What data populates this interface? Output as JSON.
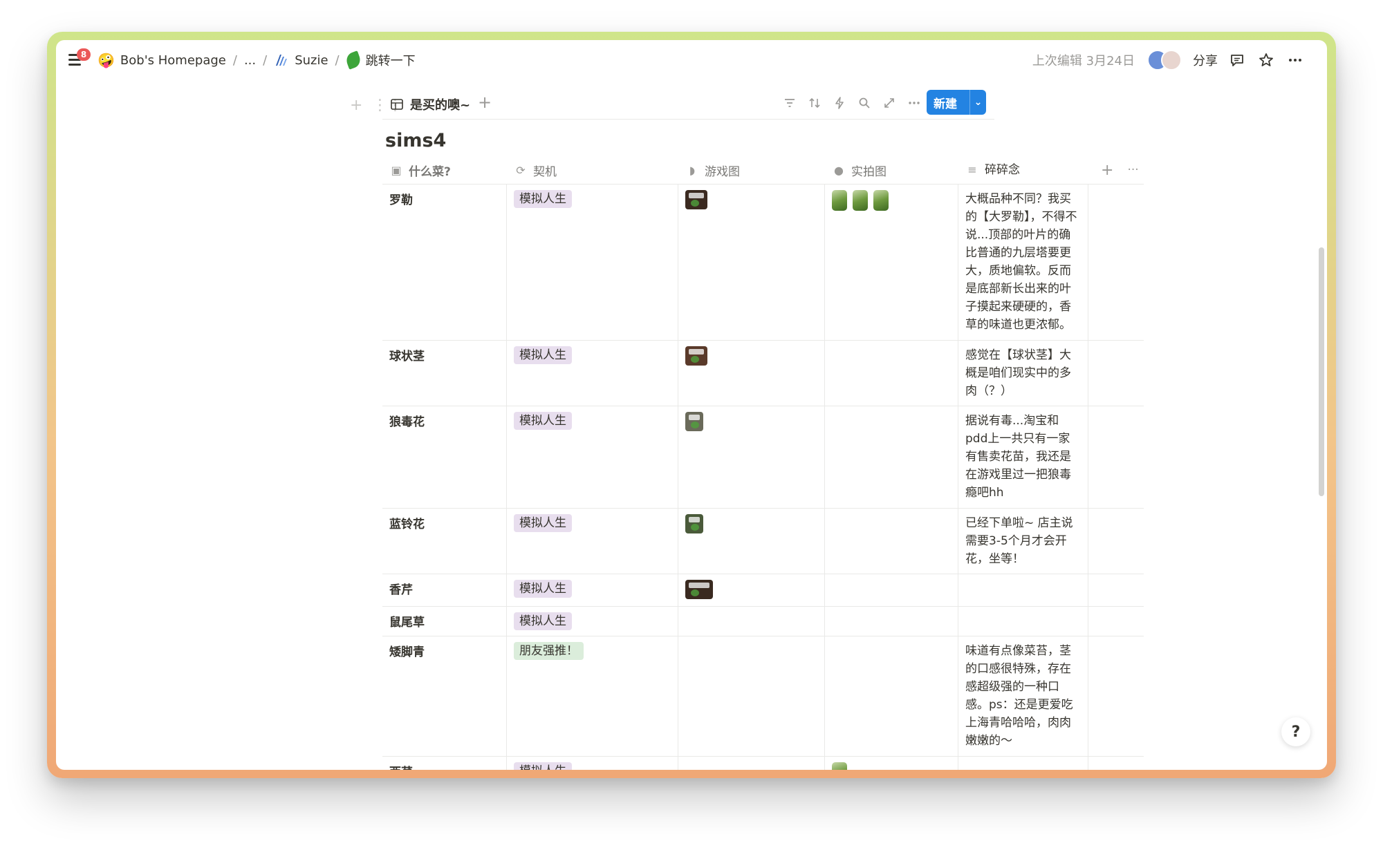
{
  "topbar": {
    "notification_count": "8",
    "breadcrumbs": [
      {
        "label": "Bob's Homepage",
        "icon": "emoji-face-icon"
      },
      {
        "label": "..."
      },
      {
        "label": "Suzie",
        "icon": "notion-logo-icon"
      },
      {
        "label": "跳转一下",
        "icon": "leaf-icon"
      }
    ],
    "separator": "/",
    "last_edited": "上次编辑 3月24日",
    "share_label": "分享"
  },
  "view": {
    "tab_label": "是买的噢~",
    "new_button_label": "新建",
    "tools": [
      "filter-icon",
      "sort-icon",
      "automation-icon",
      "search-icon",
      "expand-icon",
      "more-icon"
    ]
  },
  "database": {
    "title": "sims4",
    "columns": [
      {
        "label": "什么菜?",
        "icon": "image-icon"
      },
      {
        "label": "契机",
        "icon": "sync-icon"
      },
      {
        "label": "游戏图",
        "icon": "sims-icon"
      },
      {
        "label": "实拍图",
        "icon": "apple-icon"
      },
      {
        "label": "碎碎念",
        "icon": "text-icon"
      }
    ],
    "rows": [
      {
        "name": "罗勒",
        "tag": "模拟人生",
        "tag_color": "#e8deee",
        "game_images": 1,
        "photos": 3,
        "note": "大概品种不同？我买的【大罗勒】，不得不说...顶部的叶片的确比普通的九层塔要更大，质地偏软。反而是底部新长出来的叶子摸起来硬硬的，香草的味道也更浓郁。"
      },
      {
        "name": "球状茎",
        "tag": "模拟人生",
        "tag_color": "#e8deee",
        "game_images": 1,
        "photos": 0,
        "note": "感觉在【球状茎】大概是咱们现实中的多肉（？）"
      },
      {
        "name": "狼毒花",
        "tag": "模拟人生",
        "tag_color": "#e8deee",
        "game_images": 1,
        "photos": 0,
        "note": "据说有毒...淘宝和pdd上一共只有一家有售卖花苗，我还是在游戏里过一把狼毒瘾吧hh"
      },
      {
        "name": "蓝铃花",
        "tag": "模拟人生",
        "tag_color": "#e8deee",
        "game_images": 1,
        "photos": 0,
        "note": "已经下单啦~ 店主说需要3-5个月才会开花，坐等！"
      },
      {
        "name": "香芹",
        "tag": "模拟人生",
        "tag_color": "#e8deee",
        "game_images": 1,
        "photos": 0,
        "note": ""
      },
      {
        "name": "鼠尾草",
        "tag": "模拟人生",
        "tag_color": "#e8deee",
        "game_images": 0,
        "photos": 0,
        "note": ""
      },
      {
        "name": "矮脚青",
        "tag": "朋友强推！",
        "tag_color": "#dbeddb",
        "game_images": 0,
        "photos": 0,
        "note": "味道有点像菜苔，茎的口感很特殊，存在感超级强的一种口感。ps：还是更爱吃上海青哈哈哈，肉肉嫩嫩的～"
      },
      {
        "name": "西芹",
        "tag": "模拟人生",
        "tag_color": "#e8deee",
        "game_images": 0,
        "photos": 1,
        "note": ""
      }
    ]
  },
  "colors": {
    "accent": "#2383e2",
    "badge": "#eb5757",
    "tag_purple": "#e8deee",
    "tag_green": "#dbeddb"
  }
}
